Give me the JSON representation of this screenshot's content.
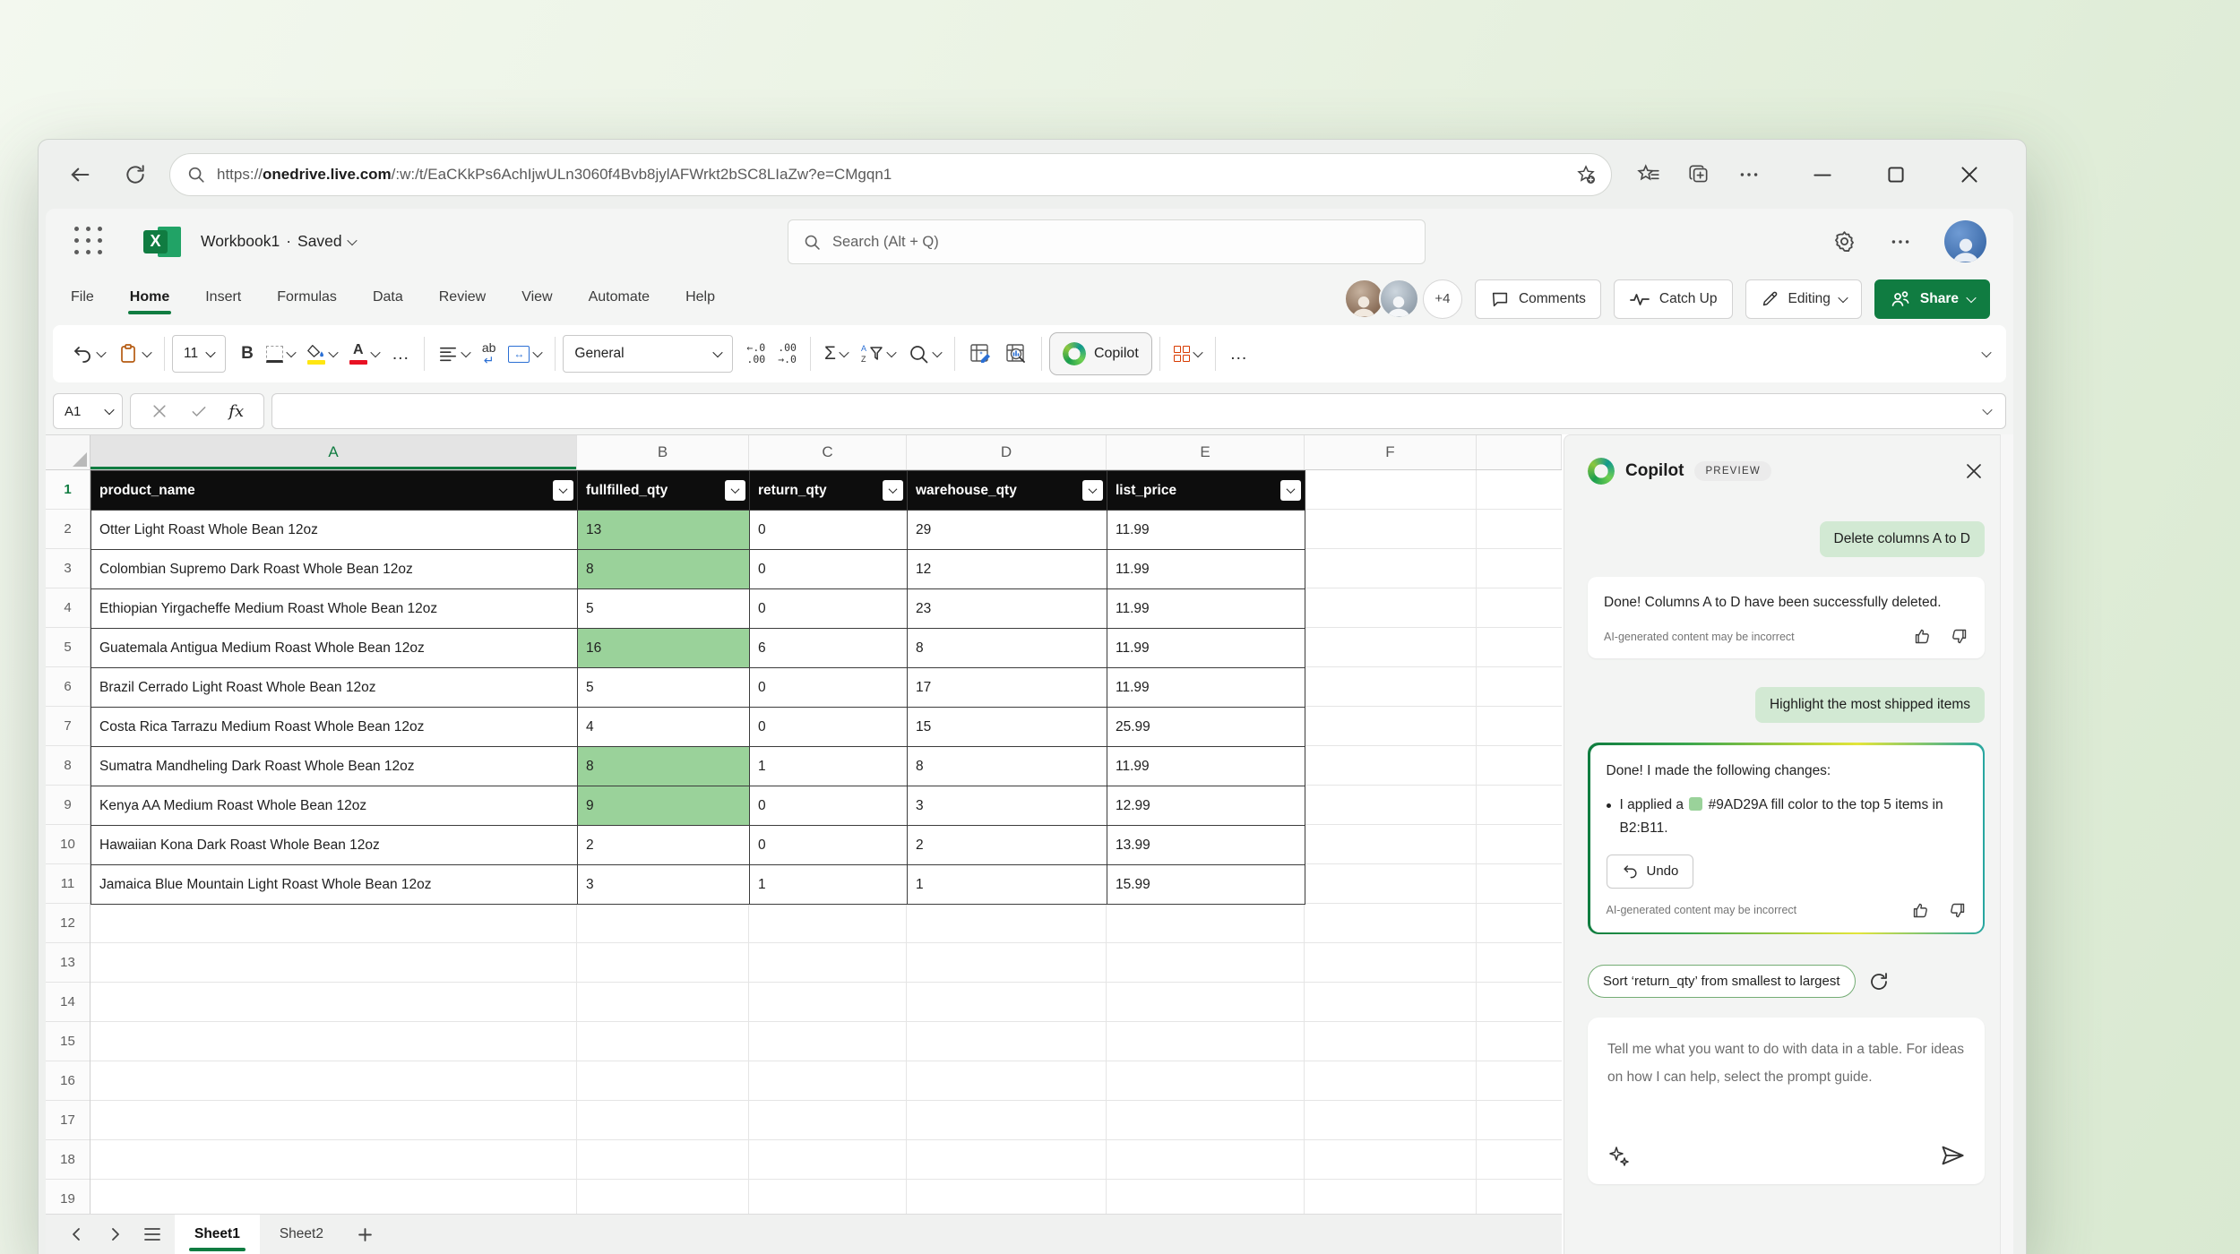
{
  "browser": {
    "url_scheme": "https://",
    "url_host": "onedrive.live.com",
    "url_path": "/:w:/t/EaCKkPs6AchIjwULn3060f4Bvb8jylAFWrkt2bSC8LIaZw?e=CMgqn1"
  },
  "excel_header": {
    "workbook_name": "Workbook1",
    "separator": "·",
    "save_status": "Saved",
    "search_placeholder": "Search (Alt + Q)"
  },
  "menu": {
    "tabs": [
      "File",
      "Home",
      "Insert",
      "Formulas",
      "Data",
      "Review",
      "View",
      "Automate",
      "Help"
    ],
    "active_tab": "Home",
    "presence_overflow": "+4",
    "comments_label": "Comments",
    "catch_up_label": "Catch Up",
    "editing_label": "Editing",
    "share_label": "Share"
  },
  "toolbar": {
    "font_size": "11",
    "number_format": "General",
    "copilot_label": "Copilot",
    "glyphs": {
      "bold": "B",
      "font_color": "A",
      "wrap_text": "ab",
      "autosum": "Σ",
      "dec_decrease_top": "←.0",
      "dec_decrease_bottom": ".00",
      "dec_increase_top": ".00",
      "dec_increase_bottom": "→.0",
      "more": "…"
    }
  },
  "formula_bar": {
    "name_box": "A1",
    "fx_glyph": "fx"
  },
  "sheet": {
    "columns": [
      "A",
      "B",
      "C",
      "D",
      "E",
      "F"
    ],
    "selected_column": "A",
    "selected_cell": "A1",
    "row_count": 19,
    "selected_row": 1,
    "table": {
      "headers": [
        "product_name",
        "fullfilled_qty",
        "return_qty",
        "warehouse_qty",
        "list_price"
      ],
      "rows": [
        [
          "Otter Light Roast Whole Bean 12oz",
          "13",
          "0",
          "29",
          "11.99"
        ],
        [
          "Colombian Supremo Dark Roast Whole Bean 12oz",
          "8",
          "0",
          "12",
          "11.99"
        ],
        [
          "Ethiopian Yirgacheffe Medium Roast Whole Bean 12oz",
          "5",
          "0",
          "23",
          "11.99"
        ],
        [
          "Guatemala Antigua Medium Roast Whole Bean 12oz",
          "16",
          "6",
          "8",
          "11.99"
        ],
        [
          "Brazil Cerrado Light Roast Whole Bean 12oz",
          "5",
          "0",
          "17",
          "11.99"
        ],
        [
          "Costa Rica Tarrazu Medium Roast Whole Bean 12oz",
          "4",
          "0",
          "15",
          "25.99"
        ],
        [
          "Sumatra Mandheling Dark Roast Whole Bean 12oz",
          "8",
          "1",
          "8",
          "11.99"
        ],
        [
          "Kenya AA Medium Roast Whole Bean 12oz",
          "9",
          "0",
          "3",
          "12.99"
        ],
        [
          "Hawaiian Kona Dark Roast Whole Bean 12oz",
          "2",
          "0",
          "2",
          "13.99"
        ],
        [
          "Jamaica Blue Mountain Light Roast Whole Bean 12oz",
          "3",
          "1",
          "1",
          "15.99"
        ]
      ],
      "highlighted_fulfilled_rows": [
        2,
        3,
        5,
        8,
        9
      ],
      "highlight_fill_color": "#9AD29A"
    }
  },
  "sheet_tabs": {
    "tabs": [
      "Sheet1",
      "Sheet2"
    ],
    "active": "Sheet1"
  },
  "copilot": {
    "title": "Copilot",
    "badge": "PREVIEW",
    "messages": [
      {
        "role": "user",
        "text": "Delete columns A to D"
      },
      {
        "role": "assistant",
        "text": "Done! Columns A to D have been successfully deleted.",
        "disclaimer": "AI-generated content may be incorrect"
      },
      {
        "role": "user",
        "text": "Highlight the most shipped items"
      },
      {
        "role": "assistant",
        "intro": "Done! I made the following changes:",
        "bullet_pre": "I applied a",
        "color_code": "#9AD29A",
        "bullet_post": "fill color to the top 5 items in B2:B11.",
        "undo_label": "Undo",
        "disclaimer": "AI-generated content may be incorrect"
      }
    ],
    "suggestion": "Sort ‘return_qty’ from smallest to largest",
    "input_placeholder": "Tell me what you want to do with data in a table. For ideas on how I can help, select the prompt guide."
  },
  "colors": {
    "accent_green": "#107C41",
    "table_header_bg": "#0D0D0D",
    "highlight_green": "#9AD29A",
    "chip_green": "#D2E9D3",
    "styles_icon_orange": "#D83B01"
  },
  "icons": [
    "back-arrow",
    "refresh",
    "search",
    "add-favorite-star",
    "favorites-star",
    "collections",
    "ellipsis",
    "minimize",
    "maximize",
    "close",
    "app-launcher",
    "excel-logo",
    "gear",
    "profile-avatar",
    "comments-bubble",
    "catch-up-pulse",
    "editing-pencil",
    "share-people",
    "undo",
    "paste-clipboard",
    "borders-grid",
    "fill-color-bucket",
    "font-color",
    "align",
    "wrap-text",
    "merge-cells",
    "decrease-decimal",
    "increase-decimal",
    "autosum",
    "sort-filter",
    "find",
    "clean-data",
    "analyze-data",
    "copilot-logo",
    "table-styles",
    "cancel-x",
    "enter-check",
    "fx",
    "select-all-triangle",
    "filter-chevron",
    "thumb-up",
    "thumb-down",
    "sparkle-prompt-guide",
    "send-plane",
    "refresh-suggestion",
    "prev-sheet",
    "next-sheet",
    "sheet-list",
    "add-sheet"
  ]
}
